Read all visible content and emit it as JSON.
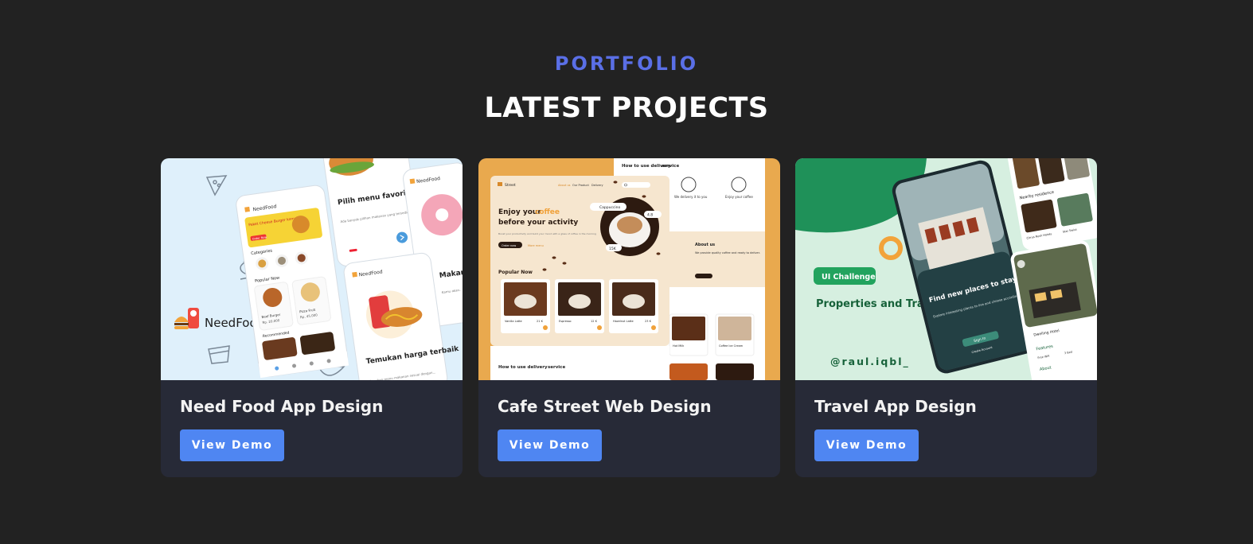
{
  "section": {
    "label": "PORTFOLIO",
    "title": "LATEST PROJECTS"
  },
  "projects": [
    {
      "title": "Need Food App Design",
      "button_label": "View Demo",
      "thumbnail": {
        "brand": "NeedFood",
        "promo": "Paket Cheese Burger komplit",
        "promo_button": "Order Now",
        "categories_label": "Categories",
        "popular_label": "Popular Now",
        "item1_name": "Beef Burger",
        "item1_price": "Rp. 20.000",
        "item2_name": "Pizza Fruit",
        "item2_price": "Rp. 45.000",
        "recommended_label": "Recommended",
        "onboard1": "Pilih menu favoritemu",
        "onboard1_sub": "Ada banyak pilihan makanan yang tersedia disini",
        "onboard2": "Makan siap d",
        "onboard2_sub": "Kamu akan..",
        "onboard3": "Temukan harga terbaik",
        "onboard3_sub": "Temukan menu makanan sesuai dengan..."
      }
    },
    {
      "title": "Cafe Street Web Design",
      "button_label": "View Demo",
      "thumbnail": {
        "brand": "Street",
        "nav": [
          "About us",
          "Our Product",
          "Delivery"
        ],
        "hero_line1": "Enjoy your",
        "hero_highlight": "coffee",
        "hero_line2": "before your activity",
        "hero_desc": "Boost your productivity and build your mood with a glass of coffee in the morning",
        "hero_btn": "Order now",
        "hero_more": "More menu",
        "badge": "Cappuccino",
        "rating": "4.8",
        "price_badge": "15K",
        "popular_label": "Popular Now",
        "products": [
          {
            "name": "Vanilla Latte",
            "price": "21 K"
          },
          {
            "name": "Espresso",
            "price": "12 K"
          },
          {
            "name": "Hazelnut Latte",
            "price": "23 K"
          }
        ],
        "delivery_title": "How to use delivery",
        "delivery_highlight": "service",
        "step1": "We delivery it to you",
        "step2": "Enjoy your coffee",
        "about_label": "About us",
        "about_title": "We provide quality coffee and ready to deliver.",
        "about_btn": "Get your coffee",
        "menu_items": [
          {
            "name": "Hot Milk",
            "price": "12 K"
          },
          {
            "name": "Coffee Ice Cream",
            "price": "19 K"
          }
        ]
      }
    },
    {
      "title": "Travel App Design",
      "button_label": "View Demo",
      "thumbnail": {
        "tag": "UI Challenge",
        "heading": "Properties and Travel App",
        "handle": "@raul.iqbl_",
        "phone_headline": "Find new places to stay and homes",
        "phone_sub": "Explore interesting places to live and choose according to yourself",
        "sign_in": "Sign In",
        "create_account": "Create Account",
        "nearby_label": "Nearby residence",
        "listing_name": "Dwelling Hotel",
        "features_label": "Features",
        "feature1": "Free Wifi",
        "feature2": "3 Bed",
        "about_label": "About",
        "card_name": "Cirrus Rush Hotels",
        "card_name2": "Star Swiss"
      }
    }
  ],
  "colors": {
    "background": "#222222",
    "card": "#272a37",
    "accent_label": "#5a6fe6",
    "button": "#4f86f2"
  },
  "icons": [
    "pizza-icon",
    "chef-icon",
    "dessert-icon",
    "bowl-icon",
    "search-icon",
    "play-icon"
  ]
}
